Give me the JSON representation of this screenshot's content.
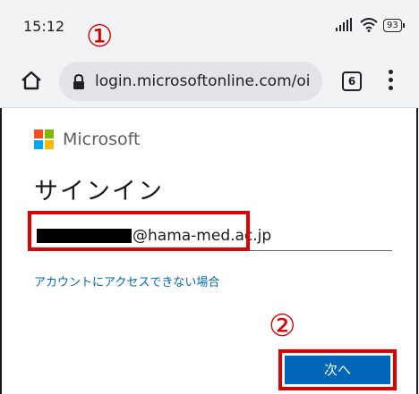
{
  "status_bar": {
    "time": "15:12",
    "battery": "93"
  },
  "browser": {
    "url": "login.microsoftonline.com/oi",
    "tab_count": "6"
  },
  "page": {
    "brand": "Microsoft",
    "title": "サインイン",
    "email_domain": "@hama-med.ac.jp",
    "help_link": "アカウントにアクセスできない場合",
    "next_button": "次へ"
  },
  "annotations": {
    "marker_1": "①",
    "marker_2": "②",
    "highlight_color": "#e00000"
  },
  "colors": {
    "ms_red": "#f25022",
    "ms_green": "#7fba00",
    "ms_blue": "#00a4ef",
    "ms_yellow": "#ffb900",
    "accent": "#0067b8"
  }
}
